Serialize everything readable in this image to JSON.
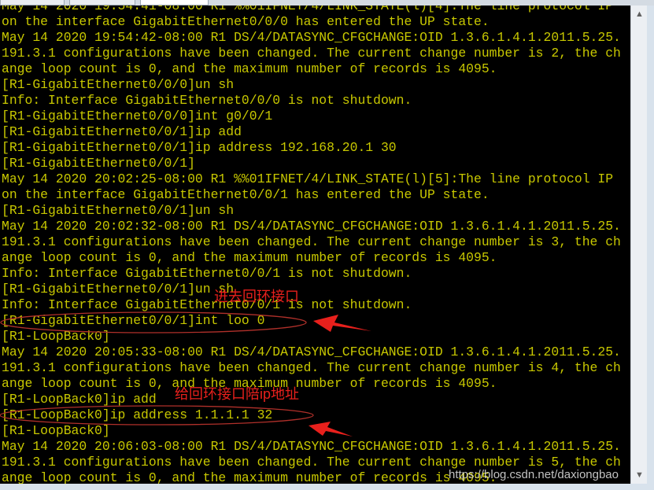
{
  "terminal": {
    "text_color": "#c8c800",
    "lines": [
      "May 14 2020 19:54:41-08:00 R1 %%01IFNET/4/LINK_STATE(l)[4]:The line protocol IP",
      "on the interface GigabitEthernet0/0/0 has entered the UP state.",
      "May 14 2020 19:54:42-08:00 R1 DS/4/DATASYNC_CFGCHANGE:OID 1.3.6.1.4.1.2011.5.25.",
      "191.3.1 configurations have been changed. The current change number is 2, the ch",
      "ange loop count is 0, and the maximum number of records is 4095.",
      "[R1-GigabitEthernet0/0/0]un sh",
      "Info: Interface GigabitEthernet0/0/0 is not shutdown.",
      "[R1-GigabitEthernet0/0/0]int g0/0/1",
      "[R1-GigabitEthernet0/0/1]ip add",
      "[R1-GigabitEthernet0/0/1]ip address 192.168.20.1 30",
      "[R1-GigabitEthernet0/0/1]",
      "May 14 2020 20:02:25-08:00 R1 %%01IFNET/4/LINK_STATE(l)[5]:The line protocol IP",
      "on the interface GigabitEthernet0/0/1 has entered the UP state.",
      "[R1-GigabitEthernet0/0/1]un sh",
      "May 14 2020 20:02:32-08:00 R1 DS/4/DATASYNC_CFGCHANGE:OID 1.3.6.1.4.1.2011.5.25.",
      "191.3.1 configurations have been changed. The current change number is 3, the ch",
      "ange loop count is 0, and the maximum number of records is 4095.",
      "Info: Interface GigabitEthernet0/0/1 is not shutdown.",
      "[R1-GigabitEthernet0/0/1]un sh",
      "Info: Interface GigabitEthernet0/0/1 is not shutdown.",
      "[R1-GigabitEthernet0/0/1]int loo 0",
      "[R1-LoopBack0]",
      "May 14 2020 20:05:33-08:00 R1 DS/4/DATASYNC_CFGCHANGE:OID 1.3.6.1.4.1.2011.5.25.",
      "191.3.1 configurations have been changed. The current change number is 4, the ch",
      "ange loop count is 0, and the maximum number of records is 4095.",
      "[R1-LoopBack0]ip add",
      "[R1-LoopBack0]ip address 1.1.1.1 32",
      "[R1-LoopBack0]",
      "May 14 2020 20:06:03-08:00 R1 DS/4/DATASYNC_CFGCHANGE:OID 1.3.6.1.4.1.2011.5.25.",
      "191.3.1 configurations have been changed. The current change number is 5, the ch",
      "ange loop count is 0, and the maximum number of records is 4095."
    ]
  },
  "annotations": {
    "color": "#e8201c",
    "note1": "进去回环接口",
    "note2": "给回环接口陪ip地址"
  },
  "scrollbar": {
    "up_icon": "chevron-up-icon",
    "down_icon": "chevron-down-icon"
  },
  "watermark": "https://blog.csdn.net/daxiongbao"
}
